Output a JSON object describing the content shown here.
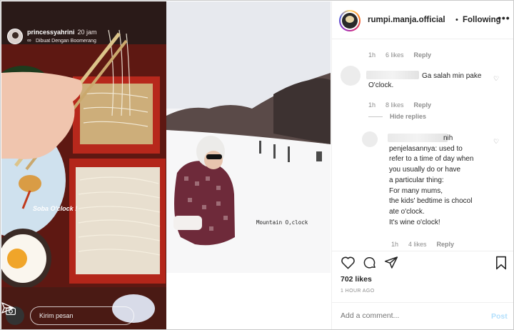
{
  "story": {
    "username": "princessyahrini",
    "time": "20 jam",
    "subtitle": "Dibuat Dengan Boomerang",
    "caption": "Soba O'clock !",
    "reply_placeholder": "Kirim pesan"
  },
  "snow_photo": {
    "caption": "Mountain O,clock"
  },
  "post": {
    "username": "rumpi.manja.official",
    "separator": "•",
    "follow_status": "Following",
    "more": "•••"
  },
  "comments": [
    {
      "time": "1h",
      "likes": "6 likes",
      "reply": "Reply"
    },
    {
      "text": "Ga salah min pake O'clock.",
      "time": "1h",
      "likes": "8 likes",
      "reply": "Reply"
    }
  ],
  "hide_replies": "Hide replies",
  "reply_comment": {
    "lines": [
      "nih",
      "penjelasannya: used to",
      "refer to a time of day when",
      "you usually do or have",
      "a particular thing:",
      "For many mums,",
      "the kids' bedtime is chocol",
      "ate o'clock.",
      "It's wine o'clock!"
    ],
    "time": "1h",
    "likes": "4 likes",
    "reply": "Reply"
  },
  "actions": {
    "icons": [
      "heart-icon",
      "comment-icon",
      "share-icon",
      "bookmark-icon"
    ]
  },
  "likes_count": "702 likes",
  "posted_ago": "1 HOUR AGO",
  "add_comment_placeholder": "Add a comment...",
  "post_button": "Post",
  "colors": {
    "text": "#262626",
    "muted": "#8e8e8e",
    "post_disabled": "#b2dffc",
    "border": "#efefef"
  }
}
